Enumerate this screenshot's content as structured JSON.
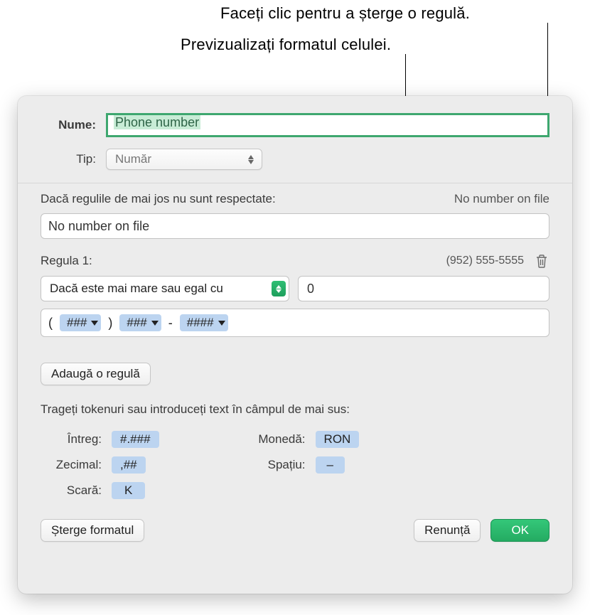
{
  "callouts": {
    "delete_rule": "Faceți clic pentru a șterge o regulă.",
    "preview_format": "Previzualizați formatul celulei."
  },
  "labels": {
    "name": "Nume:",
    "type": "Tip:"
  },
  "name_value": "Phone number",
  "type_value": "Număr",
  "default_rule": {
    "heading": "Dacă regulile de mai jos nu sunt respectate:",
    "preview": "No number on file",
    "value": "No number on file"
  },
  "rule1": {
    "heading": "Regula 1:",
    "preview": "(952) 555-5555",
    "condition": "Dacă este mai mare sau egal cu",
    "threshold": "0",
    "format_tokens": [
      "###",
      "###",
      "####"
    ]
  },
  "add_rule_btn": "Adaugă o regulă",
  "drag_help": "Trageți tokenuri sau introduceți text în câmpul de mai sus:",
  "tokens": {
    "integer_label": "Întreg:",
    "integer_value": "#.###",
    "decimal_label": "Zecimal:",
    "decimal_value": ",##",
    "scale_label": "Scară:",
    "scale_value": "K",
    "currency_label": "Monedă:",
    "currency_value": "RON",
    "space_label": "Spațiu:",
    "space_value": "–"
  },
  "footer": {
    "delete_format": "Șterge formatul",
    "cancel": "Renunță",
    "ok": "OK"
  }
}
